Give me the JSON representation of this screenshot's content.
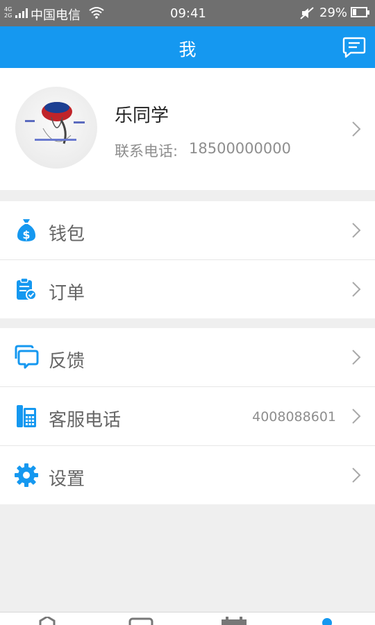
{
  "status_bar": {
    "network_top": "4G",
    "network_bottom": "2G",
    "carrier": "中国电信",
    "time": "09:41",
    "battery": "29%",
    "battery_level": 0.29
  },
  "header": {
    "title": "我",
    "message_icon": "message-icon"
  },
  "profile": {
    "name": "乐同学",
    "phone_label": "联系电话:",
    "phone": "18500000000"
  },
  "menu_group_1": [
    {
      "label": "钱包",
      "icon": "wallet-icon"
    },
    {
      "label": "订单",
      "icon": "order-icon"
    }
  ],
  "menu_group_2": [
    {
      "label": "反馈",
      "icon": "feedback-icon"
    },
    {
      "label": "客服电话",
      "icon": "phone-icon",
      "value": "4008088601"
    },
    {
      "label": "设置",
      "icon": "settings-icon"
    }
  ],
  "colors": {
    "accent": "#1598f0",
    "status_bar": "#6f6f6f",
    "background": "#efefef"
  }
}
